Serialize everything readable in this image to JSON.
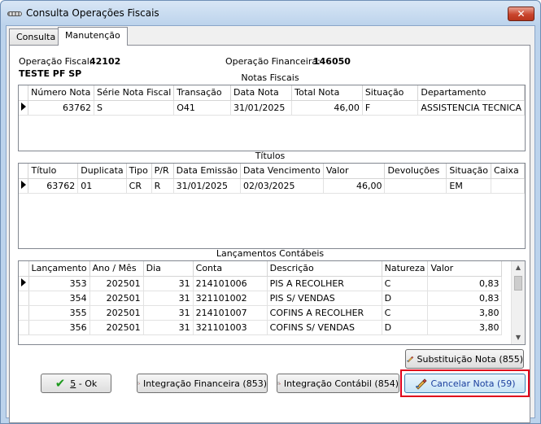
{
  "window": {
    "title": "Consulta Operações Fiscais",
    "close_label": "✕"
  },
  "tabs": [
    {
      "label": "Consulta",
      "active": false
    },
    {
      "label": "Manutenção",
      "active": true
    }
  ],
  "header": {
    "op_fiscal_label": "Operação Fiscal:",
    "op_fiscal_value": "42102",
    "op_fiscal_desc": "TESTE PF SP",
    "op_financeira_label": "Operação Financeira:",
    "op_financeira_value": "146050"
  },
  "notas_fiscais": {
    "title": "Notas Fiscais",
    "columns": [
      "Número Nota",
      "Série Nota Fiscal",
      "Transação",
      "Data Nota",
      "Total Nota",
      "Situação",
      "Departamento"
    ],
    "rows": [
      [
        "63762",
        "S",
        "O41",
        "31/01/2025",
        "46,00",
        "F",
        "ASSISTENCIA TECNICA"
      ]
    ]
  },
  "titulos": {
    "title": "Títulos",
    "columns": [
      "Título",
      "Duplicata",
      "Tipo",
      "P/R",
      "Data Emissão",
      "Data Vencimento",
      "Valor",
      "Devoluções",
      "Situação",
      "Caixa"
    ],
    "rows": [
      [
        "63762",
        "01",
        "CR",
        "R",
        "31/01/2025",
        "02/03/2025",
        "46,00",
        "",
        "EM",
        ""
      ]
    ]
  },
  "lancamentos": {
    "title": "Lançamentos Contábeis",
    "columns": [
      "Lançamento",
      "Ano / Mês",
      "Dia",
      "Conta",
      "Descrição",
      "Natureza",
      "Valor"
    ],
    "rows": [
      [
        "353",
        "202501",
        "31",
        "214101006",
        "PIS A RECOLHER",
        "C",
        "0,83"
      ],
      [
        "354",
        "202501",
        "31",
        "321101002",
        "PIS S/ VENDAS",
        "D",
        "0,83"
      ],
      [
        "355",
        "202501",
        "31",
        "214101007",
        "COFINS A RECOLHER",
        "C",
        "3,80"
      ],
      [
        "356",
        "202501",
        "31",
        "321101003",
        "COFINS S/ VENDAS",
        "D",
        "3,80"
      ]
    ]
  },
  "buttons": {
    "substituicao": "Substituição Nota (855)",
    "ok_prefix": "5",
    "ok_suffix": " - Ok",
    "integracao_financeira": "Integração Financeira (853)",
    "integracao_contabil": "Integração Contábil (854)",
    "cancelar": "Cancelar Nota (59)"
  },
  "colors": {
    "highlight": "#e0001b",
    "cancel_text": "#1a3f9e"
  }
}
